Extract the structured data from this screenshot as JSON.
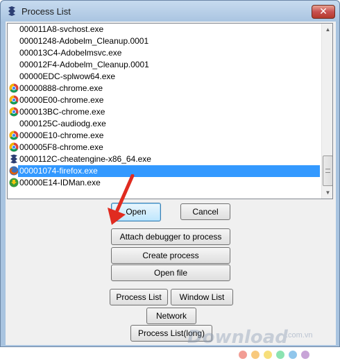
{
  "window": {
    "title": "Process List",
    "close_glyph": "✕"
  },
  "processes": [
    {
      "name": "000011A8-svchost.exe",
      "icon": "none"
    },
    {
      "name": "00001248-Adobelm_Cleanup.0001",
      "icon": "none"
    },
    {
      "name": "000013C4-Adobelmsvc.exe",
      "icon": "none"
    },
    {
      "name": "000012F4-Adobelm_Cleanup.0001",
      "icon": "none"
    },
    {
      "name": "00000EDC-splwow64.exe",
      "icon": "none"
    },
    {
      "name": "00000888-chrome.exe",
      "icon": "chrome-icon"
    },
    {
      "name": "00000E00-chrome.exe",
      "icon": "chrome-icon"
    },
    {
      "name": "000013BC-chrome.exe",
      "icon": "chrome-icon"
    },
    {
      "name": "0000125C-audiodg.exe",
      "icon": "none"
    },
    {
      "name": "00000E10-chrome.exe",
      "icon": "chrome-icon"
    },
    {
      "name": "000005F8-chrome.exe",
      "icon": "chrome-icon"
    },
    {
      "name": "0000112C-cheatengine-x86_64.exe",
      "icon": "cheatengine-icon"
    },
    {
      "name": "00001074-firefox.exe",
      "icon": "firefox-icon",
      "selected": true
    },
    {
      "name": "00000E14-IDMan.exe",
      "icon": "idm-icon"
    }
  ],
  "buttons": {
    "open": "Open",
    "cancel": "Cancel",
    "attach": "Attach debugger to process",
    "create": "Create process",
    "open_file": "Open file",
    "process_list": "Process List",
    "window_list": "Window List",
    "network": "Network",
    "process_list_long": "Process List(long)"
  },
  "watermark": {
    "brand": "Download",
    "domain": ".com.vn",
    "dot_colors": [
      "#e84c3d",
      "#f39c12",
      "#f1c40f",
      "#2ecc71",
      "#3498db",
      "#9b59b6"
    ]
  },
  "colors": {
    "selection": "#3399ff",
    "default_button_border": "#3c7fb1",
    "close_button": "#c75050",
    "annotation_arrow": "#e02b20"
  }
}
